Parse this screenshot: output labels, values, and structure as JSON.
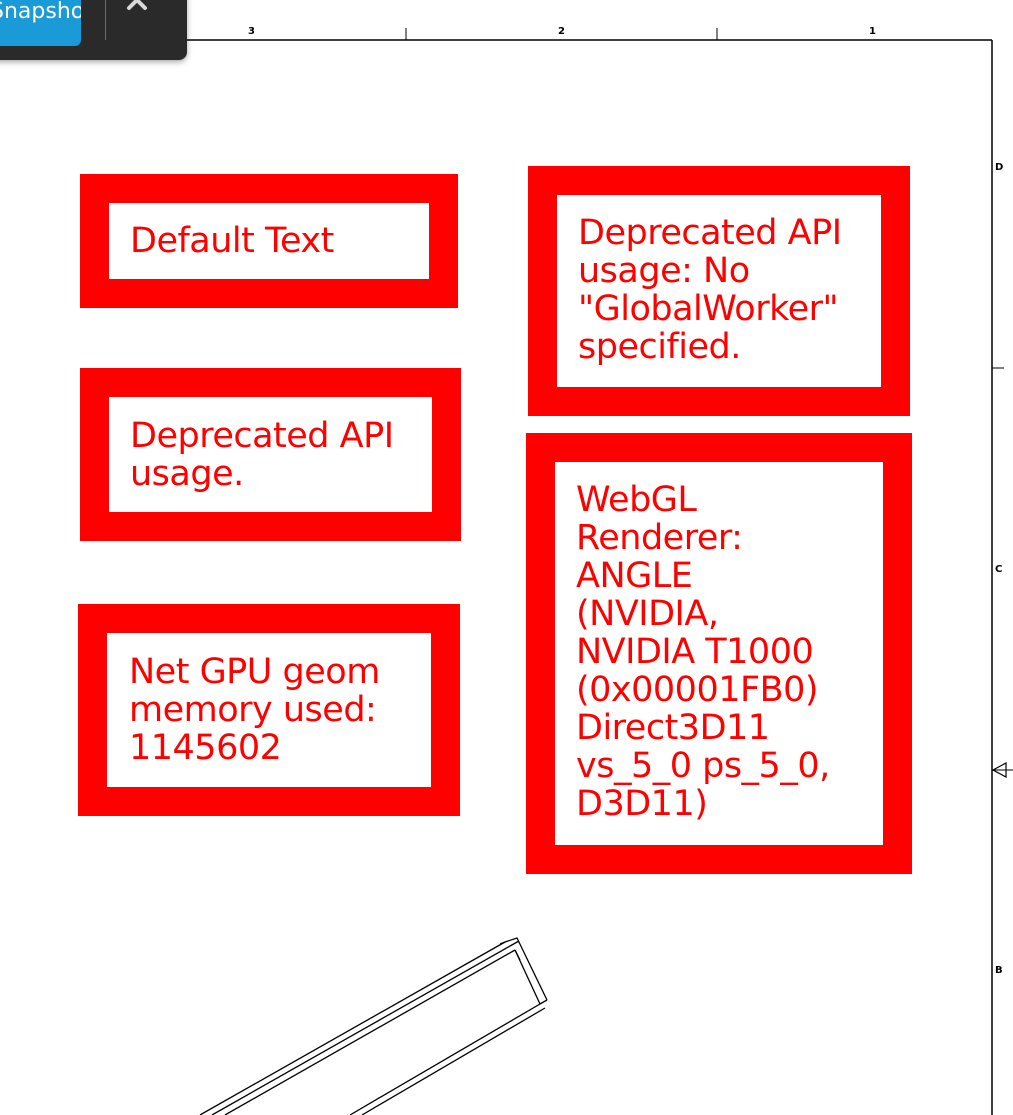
{
  "toolbar": {
    "snapshot_label": "Snapshot",
    "close_icon": "close-icon"
  },
  "sheet": {
    "column_labels": [
      "3",
      "2",
      "1"
    ],
    "row_labels": [
      "D",
      "C",
      "B"
    ],
    "view_marker_icon": "view-direction-triangle-icon"
  },
  "overlays": {
    "default_text": "Default Text",
    "deprecated_api": "Deprecated API\nusage.",
    "gpu_memory": "Net GPU geom\nmemory used:\n1145602",
    "deprecated_global_worker": "Deprecated API\nusage: No\n\"GlobalWorker\"\nspecified.",
    "webgl_renderer": "WebGL\nRenderer:\nANGLE\n(NVIDIA,\nNVIDIA T1000\n(0x00001FB0)\nDirect3D11\nvs_5_0 ps_5_0,\nD3D11)"
  },
  "colors": {
    "overlay_red": "#ff0000",
    "snapshot_blue": "#1a9ad6",
    "toolbar_dark": "#2a2a2a"
  }
}
